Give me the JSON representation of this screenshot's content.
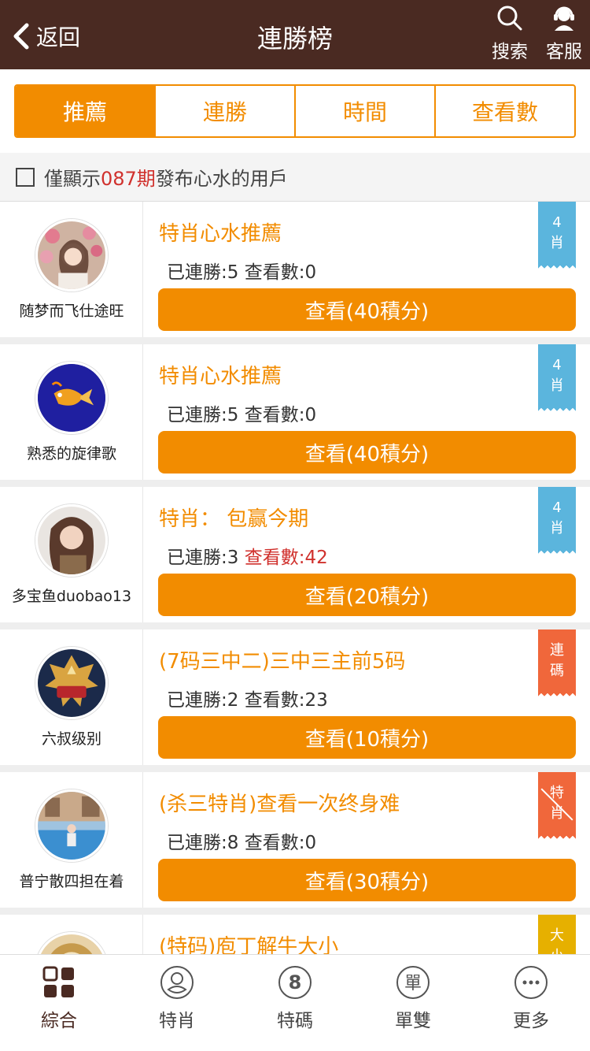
{
  "header": {
    "back_label": "返回",
    "title": "連勝榜",
    "search_label": "搜索",
    "service_label": "客服"
  },
  "tabs": [
    {
      "label": "推薦",
      "active": true
    },
    {
      "label": "連勝",
      "active": false
    },
    {
      "label": "時間",
      "active": false
    },
    {
      "label": "查看數",
      "active": false
    }
  ],
  "filter": {
    "prefix": "僅顯示",
    "period": "087期",
    "suffix": "發布心水的用戶"
  },
  "cards": [
    {
      "user": "随梦而飞仕途旺",
      "title": "特肖心水推薦",
      "streak": "已連勝:5",
      "views": "查看數:0",
      "button": "查看(40積分)",
      "tag_top": "4",
      "tag_bottom": "肖"
    },
    {
      "user": "熟悉的旋律歌",
      "title": "特肖心水推薦",
      "streak": "已連勝:5",
      "views": "查看數:0",
      "button": "查看(40積分)",
      "tag_top": "4",
      "tag_bottom": "肖"
    },
    {
      "user": "多宝鱼duobao13",
      "title": "特肖： 包赢今期",
      "streak": "已連勝:3",
      "views": "查看數:42",
      "button": "查看(20積分)",
      "tag_top": "4",
      "tag_bottom": "肖"
    },
    {
      "user": "六叔级别",
      "title": "(7码三中二)三中三主前5码",
      "streak": "已連勝:2",
      "views": "查看數:23",
      "button": "查看(10積分)",
      "tag_top": "連",
      "tag_bottom": "碼"
    },
    {
      "user": "普宁散四担在着",
      "title": "(杀三特肖)查看一次终身难",
      "streak": "已連勝:8",
      "views": "查看數:0",
      "button": "查看(30積分)",
      "tag_top": "特",
      "tag_bottom": "肖"
    },
    {
      "user": "",
      "title": "(特码)庖丁解牛大小",
      "streak": "",
      "views": "",
      "button": "",
      "tag_top": "大",
      "tag_bottom": "小"
    }
  ],
  "bottom_nav": [
    {
      "label": "綜合",
      "icon": "grid-icon",
      "active": true
    },
    {
      "label": "特肖",
      "icon": "zodiac-icon",
      "active": false
    },
    {
      "label": "特碼",
      "icon": "number-eight-icon",
      "glyph": "8",
      "active": false
    },
    {
      "label": "單雙",
      "icon": "odd-even-icon",
      "glyph": "單",
      "active": false
    },
    {
      "label": "更多",
      "icon": "more-icon",
      "active": false
    }
  ],
  "colors": {
    "header_bg": "#4a2a22",
    "accent": "#f28c00",
    "highlight_red": "#d0312d",
    "tag_blue": "#5bb5dd",
    "tag_coral": "#f0673b",
    "tag_gold": "#e6b000"
  }
}
